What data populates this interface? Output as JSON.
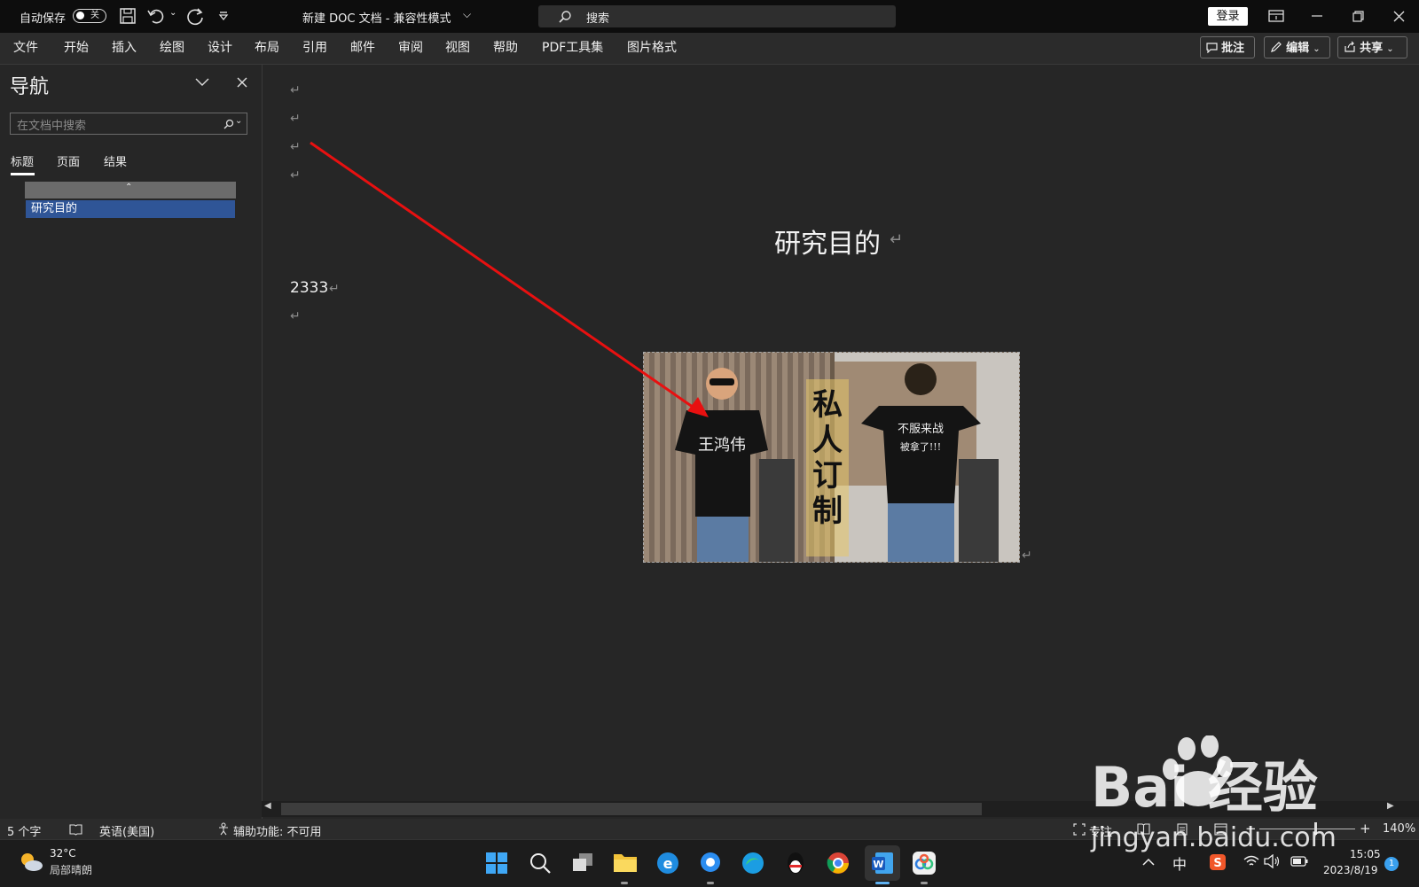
{
  "titlebar": {
    "autosave_label": "自动保存",
    "autosave_state": "关",
    "doc_title": "新建 DOC 文档  -  兼容性模式",
    "search_placeholder": "搜索",
    "login_label": "登录"
  },
  "menu": {
    "items": [
      "文件",
      "开始",
      "插入",
      "绘图",
      "设计",
      "布局",
      "引用",
      "邮件",
      "审阅",
      "视图",
      "帮助",
      "PDF工具集",
      "图片格式"
    ],
    "comment_label": "批注",
    "edit_label": "编辑",
    "share_label": "共享"
  },
  "nav": {
    "title": "导航",
    "search_placeholder": "在文档中搜索",
    "tabs": [
      "标题",
      "页面",
      "结果"
    ],
    "heading_item": "研究目的"
  },
  "document": {
    "paragraph_mark": "↵",
    "heading": "研究目的",
    "body_text": "2333",
    "photo": {
      "shirt_text_left": "王鸿伟",
      "banner_text": "私人订制",
      "shirt_text_right_1": "不服来战",
      "shirt_text_right_2": "被拿了!!!"
    }
  },
  "statusbar": {
    "word_count": "5 个字",
    "language": "英语(美国)",
    "accessibility": "辅助功能: 不可用",
    "focus_label": "专注",
    "zoom": "140%",
    "zoom_level": 0.58
  },
  "taskbar": {
    "temperature": "32°C",
    "weather": "局部晴朗",
    "ime": "中",
    "time": "15:05",
    "date": "2023/8/19",
    "notification_count": "1"
  },
  "watermark": {
    "text": "Bai 经验",
    "url": "jingyan.baidu.com"
  },
  "colors": {
    "arrow": "#e81010",
    "heading_highlight": "#2f5597",
    "titlebar_bg": "#0d0d0d",
    "doc_bg": "#262626"
  }
}
